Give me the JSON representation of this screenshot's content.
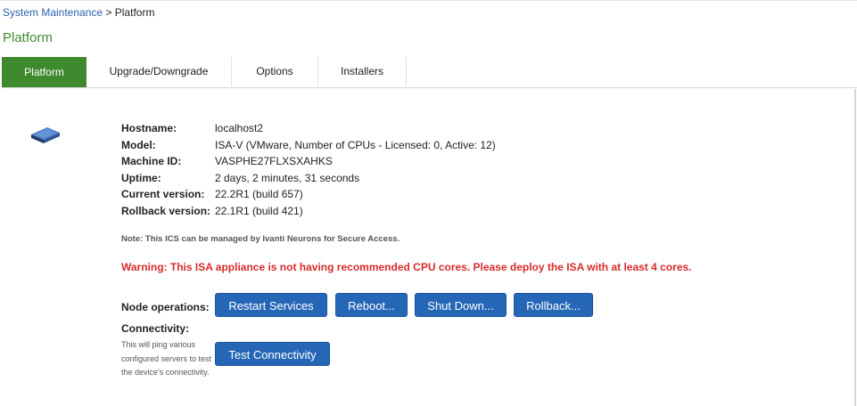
{
  "breadcrumb": {
    "parent": "System Maintenance",
    "separator": ">",
    "current": "Platform"
  },
  "page": {
    "title": "Platform"
  },
  "tabs": [
    {
      "label": "Platform",
      "active": true
    },
    {
      "label": "Upgrade/Downgrade",
      "active": false
    },
    {
      "label": "Options",
      "active": false
    },
    {
      "label": "Installers",
      "active": false
    }
  ],
  "device_icon": "server-appliance-icon",
  "info": {
    "hostname_label": "Hostname:",
    "hostname": "localhost2",
    "model_label": "Model:",
    "model": "ISA-V (VMware, Number of CPUs - Licensed: 0, Active: 12)",
    "machine_id_label": "Machine ID:",
    "machine_id": "VASPHE27FLXSXAHKS",
    "uptime_label": "Uptime:",
    "uptime": "2 days, 2 minutes, 31 seconds",
    "current_version_label": "Current version:",
    "current_version": "22.2R1 (build 657)",
    "rollback_version_label": "Rollback version:",
    "rollback_version": "22.1R1 (build 421)"
  },
  "note": "Note: This ICS can be managed by Ivanti Neurons for Secure Access.",
  "warning": "Warning: This ISA appliance is not having recommended CPU cores. Please deploy the ISA with at least 4 cores.",
  "node_operations": {
    "label": "Node operations:",
    "buttons": [
      "Restart Services",
      "Reboot...",
      "Shut Down...",
      "Rollback..."
    ]
  },
  "connectivity": {
    "title": "Connectivity:",
    "description": "This will ping various configured servers to test the device's connectivity.",
    "button": "Test Connectivity"
  },
  "colors": {
    "accent_green": "#3f8a2f",
    "button_blue": "#2567b6",
    "warning_red": "#d82b2b",
    "link_blue": "#2a62a8"
  }
}
